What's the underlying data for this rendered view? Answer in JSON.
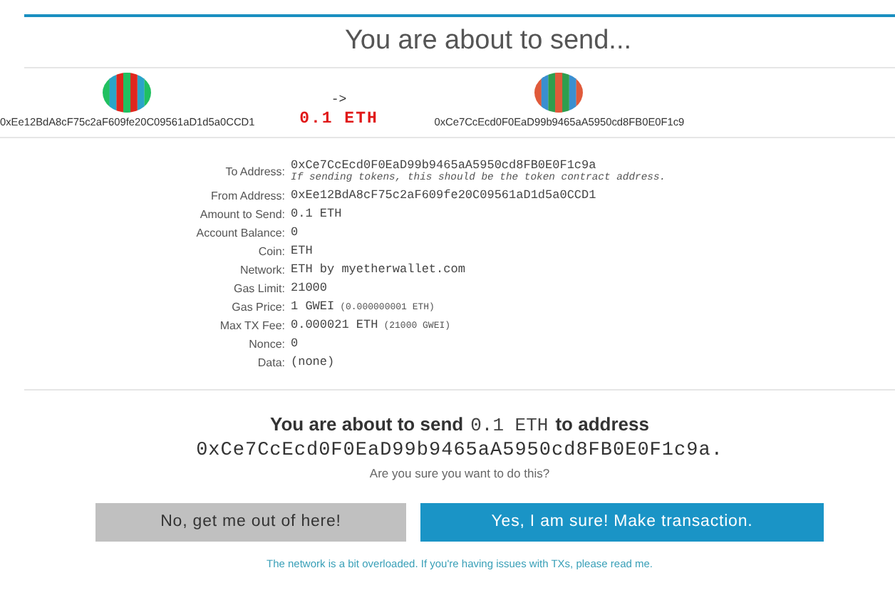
{
  "title": "You are about to send...",
  "transfer": {
    "from_address": "0xEe12BdA8cF75c2aF609fe20C09561aD1d5a0CCD1",
    "arrow": "->",
    "amount": "0.1 ETH",
    "to_address": "0xCe7CcEcd0F0EaD99b9465aA5950cd8FB0E0F1c9"
  },
  "details": [
    {
      "label": "To Address:",
      "value": "0xCe7CcEcd0F0EaD99b9465aA5950cd8FB0E0F1c9a",
      "note": "If sending tokens, this should be the token contract address."
    },
    {
      "label": "From Address:",
      "value": "0xEe12BdA8cF75c2aF609fe20C09561aD1d5a0CCD1"
    },
    {
      "label": "Amount to Send:",
      "value": "0.1 ETH"
    },
    {
      "label": "Account Balance:",
      "value": "0"
    },
    {
      "label": "Coin:",
      "value": "ETH"
    },
    {
      "label": "Network:",
      "value": "ETH by myetherwallet.com"
    },
    {
      "label": "Gas Limit:",
      "value": "21000"
    },
    {
      "label": "Gas Price:",
      "value": "1 GWEI",
      "extra": "(0.000000001 ETH)"
    },
    {
      "label": "Max TX Fee:",
      "value": "0.000021 ETH",
      "extra": "(21000 GWEI)"
    },
    {
      "label": "Nonce:",
      "value": "0"
    },
    {
      "label": "Data:",
      "value": "(none)"
    }
  ],
  "confirm": {
    "before": "You are about to send",
    "amount": "0.1 ETH",
    "after": "to address",
    "address": "0xCe7CcEcd0F0EaD99b9465aA5950cd8FB0E0F1c9a.",
    "question": "Are you sure you want to do this?"
  },
  "buttons": [
    {
      "label": "No, get me out of here!",
      "kind": "cancel"
    },
    {
      "label": "Yes, I am sure! Make transaction.",
      "kind": "confirm"
    }
  ],
  "footer": "The network is a bit overloaded. If you're having issues with TXs, please read me."
}
